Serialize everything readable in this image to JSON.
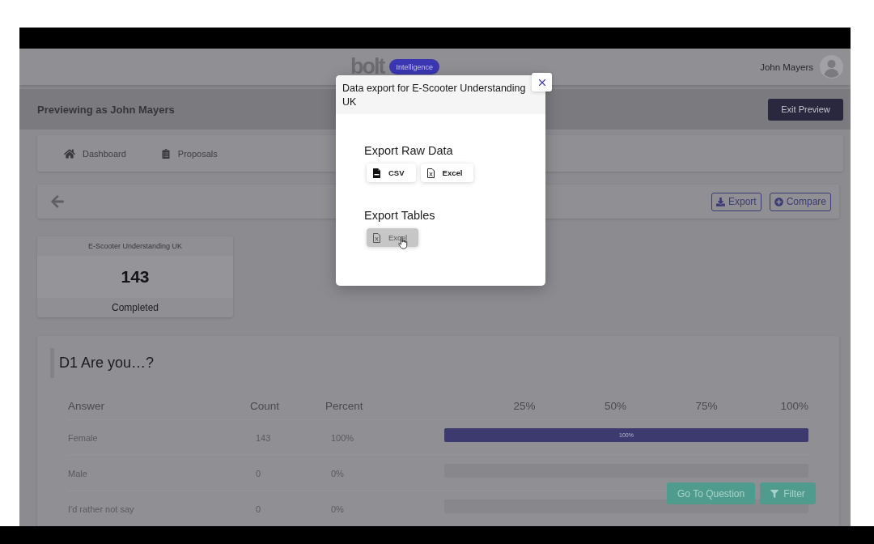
{
  "header": {
    "logo": "bolt",
    "badge": "Intelligence",
    "user_name": "John Mayers"
  },
  "preview_bar": {
    "text": "Previewing as John Mayers",
    "button": "Exit Preview"
  },
  "nav": [
    {
      "label": "Dashboard"
    },
    {
      "label": "Proposals"
    }
  ],
  "toolbar": {
    "buttons": [
      "Export",
      "Compare"
    ]
  },
  "stat_card": {
    "title": "E-Scooter Understanding UK",
    "value": "143",
    "label": "Completed"
  },
  "question": {
    "title": "D1 Are you…?",
    "columns": [
      "Answer",
      "Count",
      "Percent"
    ],
    "scale": [
      "25%",
      "50%",
      "75%",
      "100%"
    ],
    "rows": [
      {
        "answer": "Female",
        "count": "143",
        "percent": "100%",
        "level": 1,
        "bar_label": "100%"
      },
      {
        "answer": "Male",
        "count": "0",
        "percent": "0%",
        "level": 0
      },
      {
        "answer": "I'd rather not say",
        "count": "0",
        "percent": "0%",
        "level": 0
      }
    ]
  },
  "floating_buttons": [
    "Go To Question",
    "Filter"
  ],
  "modal": {
    "title": "Data export for E-Scooter Understanding UK",
    "sections": [
      {
        "heading": "Export Raw Data",
        "buttons": [
          {
            "label": "CSV",
            "kind": "csv",
            "hovered": false
          },
          {
            "label": "Excel",
            "kind": "excel",
            "hovered": false
          }
        ]
      },
      {
        "heading": "Export Tables",
        "buttons": [
          {
            "label": "Excel",
            "kind": "excel",
            "hovered": true
          }
        ]
      }
    ]
  }
}
